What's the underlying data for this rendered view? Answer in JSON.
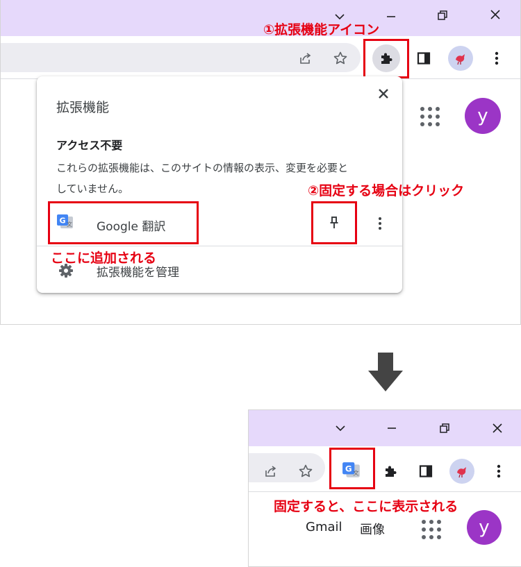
{
  "top": {
    "window_controls": {
      "chevron": "chevron-down",
      "minimize": "minimize",
      "restore": "restore",
      "close": "close"
    },
    "annotation_extension_icon": "①拡張機能アイコン",
    "popup": {
      "title": "拡張機能",
      "section_heading": "アクセス不要",
      "description_line1": "これらの拡張機能は、このサイトの情報の表示、変更を必要と",
      "description_line2": "していません。",
      "extension_name": "Google 翻訳",
      "manage_label": "拡張機能を管理"
    },
    "annotation_pin": "②固定する場合はクリック",
    "annotation_added": "ここに追加される",
    "avatar_letter": "y"
  },
  "bottom": {
    "annotation_shown": "固定すると、ここに表示される",
    "link_gmail": "Gmail",
    "link_images": "画像",
    "avatar_letter": "y"
  },
  "colors": {
    "titlebar": "#e6d9fb",
    "annotation_red": "#e60012",
    "avatar_purple": "#9b35c6",
    "arrow_gray": "#444444",
    "translate_blue": "#4285f4"
  }
}
